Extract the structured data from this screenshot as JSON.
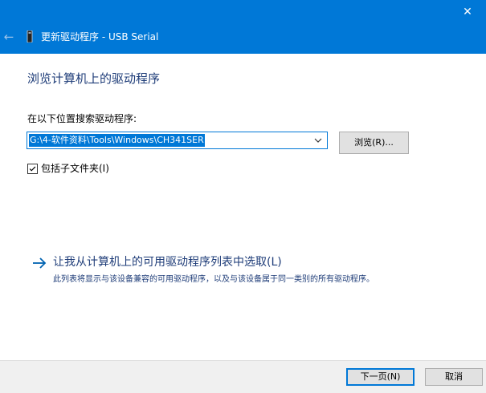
{
  "window": {
    "title": "更新驱动程序 - USB Serial",
    "accent_color": "#0078d7",
    "close_icon": "close-icon",
    "back_icon": "back-arrow-icon",
    "device_icon": "usb-device-icon"
  },
  "main": {
    "heading": "浏览计算机上的驱动程序",
    "search_label": "在以下位置搜索驱动程序:",
    "path_value": "G:\\4-软件资料\\Tools\\Windows\\CH341SER",
    "browse_label": "浏览(R)...",
    "include_subfolders_label": "包括子文件夹(I)",
    "include_subfolders_checked": true,
    "pick_link_label": "让我从计算机上的可用驱动程序列表中选取(L)",
    "pick_link_description": "此列表将显示与该设备兼容的可用驱动程序，以及与该设备属于同一类别的所有驱动程序。"
  },
  "footer": {
    "next_label": "下一页(N)",
    "cancel_label": "取消"
  }
}
